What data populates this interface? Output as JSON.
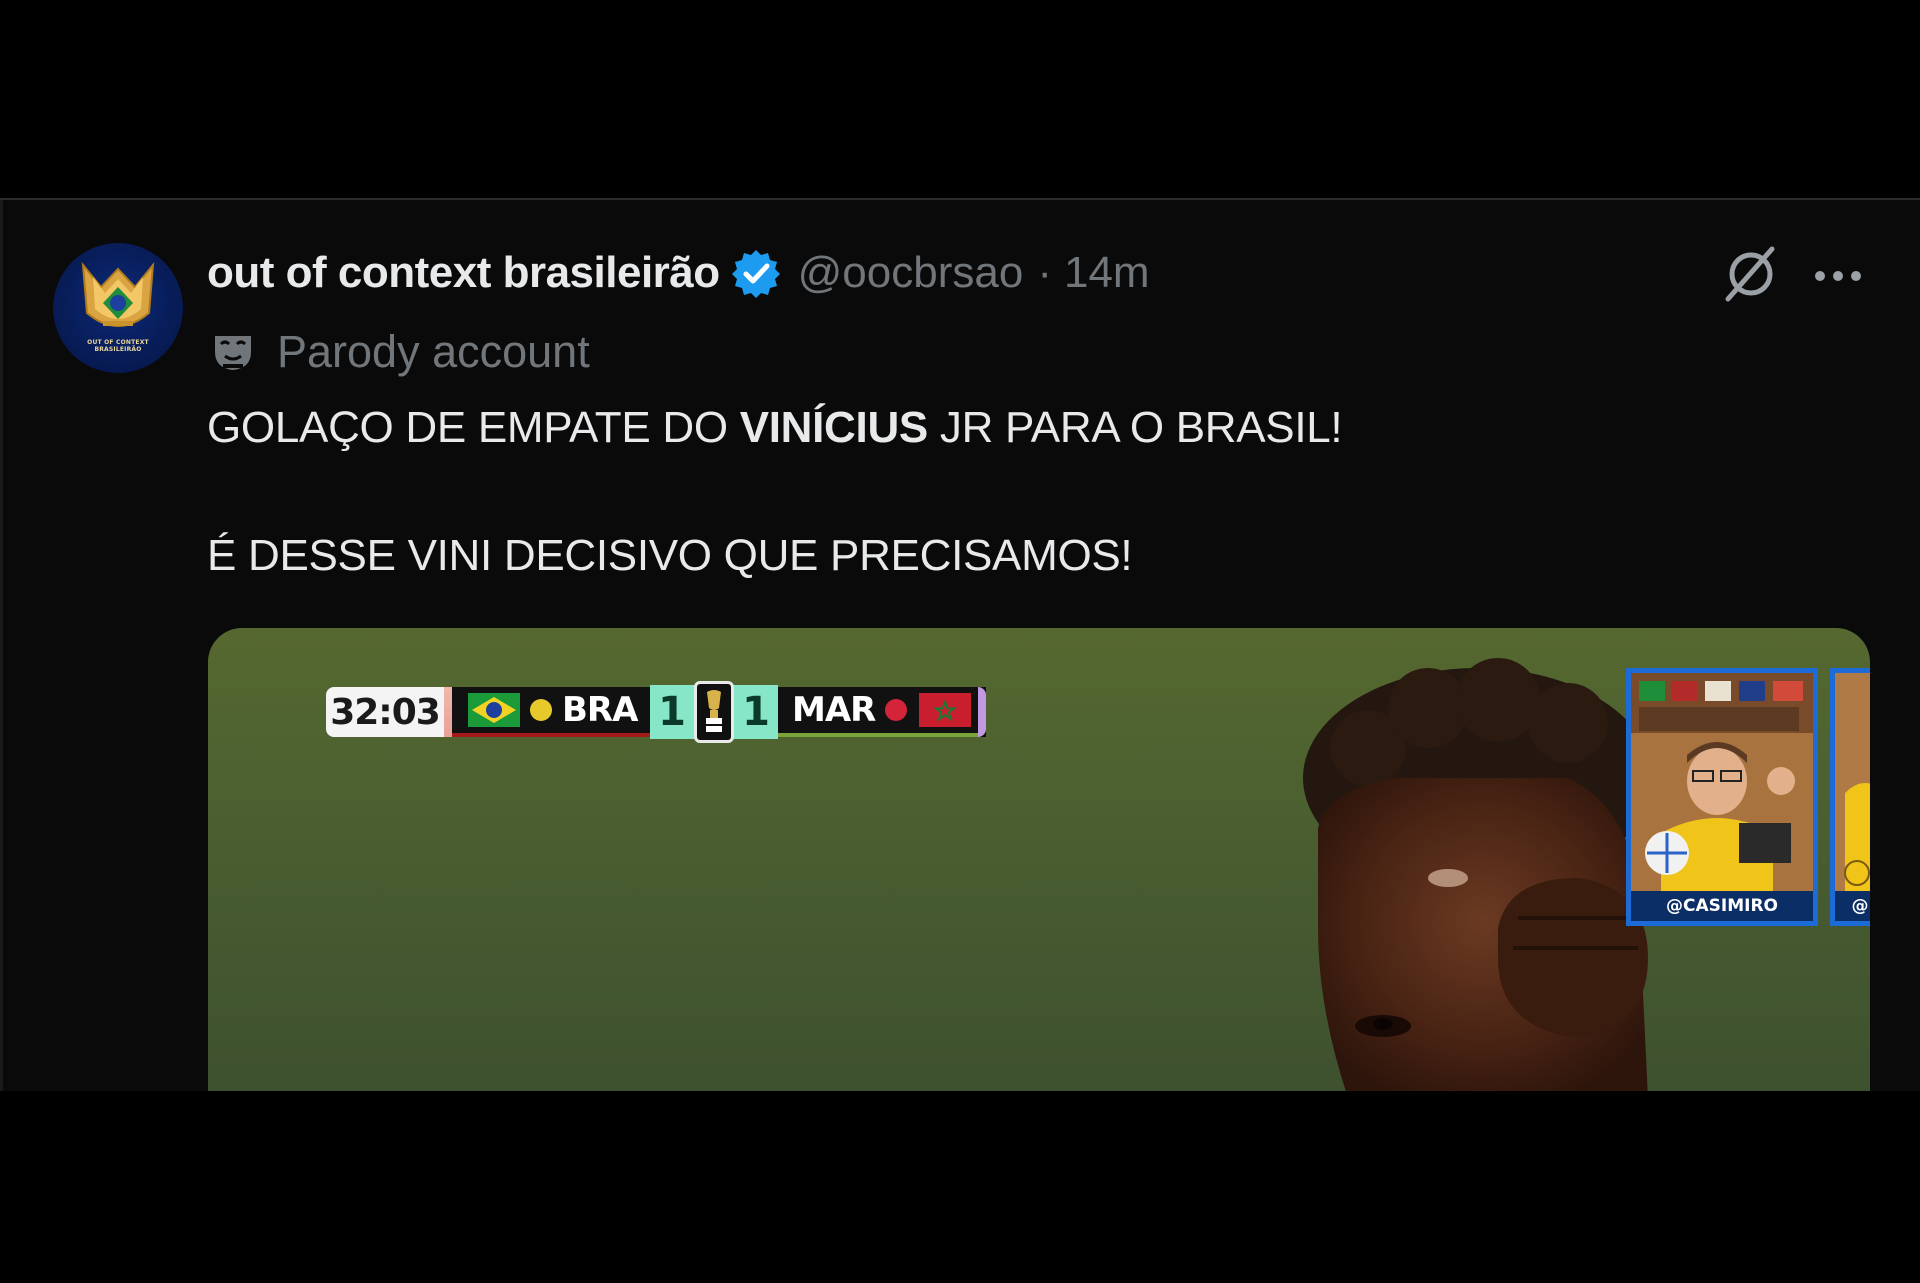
{
  "tweet": {
    "display_name": "out of context brasileirão",
    "handle": "@oocbrsao",
    "separator": "·",
    "time": "14m",
    "parody_label": "Parody account",
    "avatar_text_line1": "OUT OF CONTEXT",
    "avatar_text_line2": "BRASILEIRÃO",
    "text_line1_part1": "GOLAÇO DE EMPATE DO ",
    "text_line1_bold": "VINÍCIUS",
    "text_line1_part2": " JR PARA O BRASIL!",
    "text_line2": "É DESSE VINI DECISIVO QUE PRECISAMOS!"
  },
  "media": {
    "clock": "32:03",
    "home_team": "BRA",
    "home_score": "1",
    "away_team": "MAR",
    "away_score": "1",
    "cam_label": "@CASIMIRO"
  },
  "icons": {
    "verified": "verified-badge-icon",
    "parody": "theater-mask-icon",
    "grok": "grok-icon",
    "more": "more-dots-icon"
  },
  "colors": {
    "verified_blue": "#1d9bf0",
    "text_primary": "#e7e9ea",
    "text_secondary": "#71767b",
    "home_dot": "#e6c92a",
    "away_dot": "#d3243a"
  }
}
